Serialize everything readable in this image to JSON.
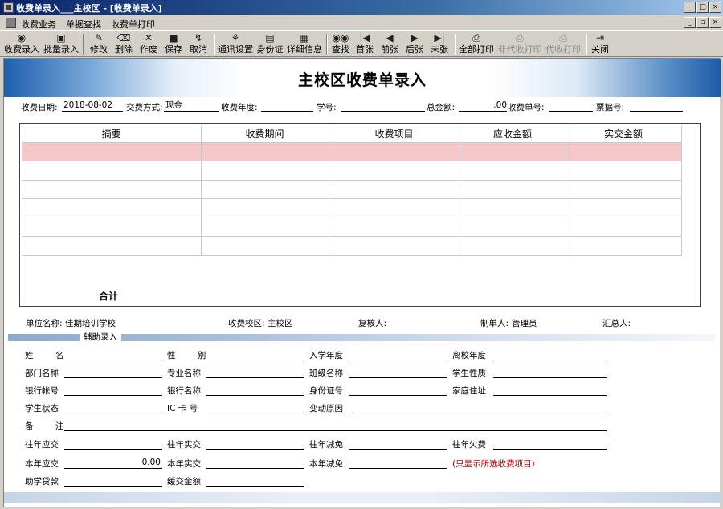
{
  "window": {
    "title": "收费单录入___主校区 - [收费单录入]",
    "buttons": [
      "_",
      "□",
      "×"
    ]
  },
  "menubar": {
    "items": [
      "收费业务",
      "单据查找",
      "收费单打印"
    ],
    "mdi_buttons": [
      "_",
      "▫",
      "×"
    ]
  },
  "toolbar": {
    "buttons": [
      {
        "label": "收费录入",
        "icon": "cap-icon"
      },
      {
        "label": "批量录入",
        "icon": "batch-icon"
      },
      {
        "label": "修改",
        "icon": "edit-icon"
      },
      {
        "label": "删除",
        "icon": "eraser-icon"
      },
      {
        "label": "作废",
        "icon": "x-icon"
      },
      {
        "label": "保存",
        "icon": "save-icon"
      },
      {
        "label": "取消",
        "icon": "cancel-icon"
      },
      {
        "label": "通讯设置",
        "icon": "comm-icon"
      },
      {
        "label": "身份证",
        "icon": "idcard-icon"
      },
      {
        "label": "详细信息",
        "icon": "grid-icon"
      },
      {
        "label": "查找",
        "icon": "binoculars-icon"
      },
      {
        "label": "首张",
        "icon": "first-icon"
      },
      {
        "label": "前张",
        "icon": "prev-icon"
      },
      {
        "label": "后张",
        "icon": "next-icon"
      },
      {
        "label": "末张",
        "icon": "last-icon"
      },
      {
        "label": "全部打印",
        "icon": "printer-all-icon"
      },
      {
        "label": "非代收打印",
        "icon": "printer-icon",
        "disabled": true
      },
      {
        "label": "代收打印",
        "icon": "printer-icon",
        "disabled": true
      },
      {
        "label": "关闭",
        "icon": "exit-icon"
      }
    ]
  },
  "form": {
    "title": "主校区收费单录入",
    "header": {
      "date_label": "收费日期:",
      "date_value": "2018-08-02",
      "pay_method_label": "交费方式:",
      "pay_method_value": "现金",
      "year_label": "收费年度:",
      "year_value": "",
      "student_no_label": "学号:",
      "student_no_value": "",
      "total_label": "总金额:",
      "total_value": ".00",
      "receipt_no_label": "收费单号:",
      "receipt_no_value": "",
      "ticket_no_label": "票据号:",
      "ticket_no_value": ""
    },
    "grid": {
      "columns": [
        "摘要",
        "收费期间",
        "收费项目",
        "应收金额",
        "实交金额"
      ],
      "rows": [
        [
          "",
          "",
          "",
          "",
          ""
        ],
        [
          "",
          "",
          "",
          "",
          ""
        ],
        [
          "",
          "",
          "",
          "",
          ""
        ],
        [
          "",
          "",
          "",
          "",
          ""
        ],
        [
          "",
          "",
          "",
          "",
          ""
        ],
        [
          "",
          "",
          "",
          "",
          ""
        ]
      ],
      "selected_row": 0,
      "total_label": "合计"
    },
    "footer": {
      "unit_label": "单位名称:",
      "unit_value": "佳期培训学校",
      "campus_label": "收费校区:",
      "campus_value": "主校区",
      "reviewer_label": "复核人:",
      "reviewer_value": "",
      "maker_label": "制单人:",
      "maker_value": "管理员",
      "summarizer_label": "汇总人:",
      "summarizer_value": ""
    },
    "aux": {
      "section_label": "辅助录入",
      "name_label": "姓 名",
      "gender_label": "性 别",
      "enroll_year_label": "入学年度",
      "leave_year_label": "离校年度",
      "department_label": "部门名称",
      "major_label": "专业名称",
      "class_label": "班级名称",
      "student_type_label": "学生性质",
      "bank_account_label": "银行帐号",
      "bank_name_label": "银行名称",
      "id_no_label": "身份证号",
      "address_label": "家庭住址",
      "status_label": "学生状态",
      "ic_card_label": "IC 卡 号",
      "change_reason_label": "变动原因",
      "remark_label": "备 注",
      "prev_due_label": "往年应交",
      "prev_paid_label": "往年实交",
      "prev_waived_label": "往年减免",
      "prev_owed_label": "往年欠费",
      "cur_due_label": "本年应交",
      "cur_due_value": "0.00",
      "cur_paid_label": "本年实交",
      "cur_waived_label": "本年减免",
      "note": "(只显示所选收费项目)",
      "loan_label": "助学贷款",
      "deferred_label": "缓交金额"
    }
  }
}
